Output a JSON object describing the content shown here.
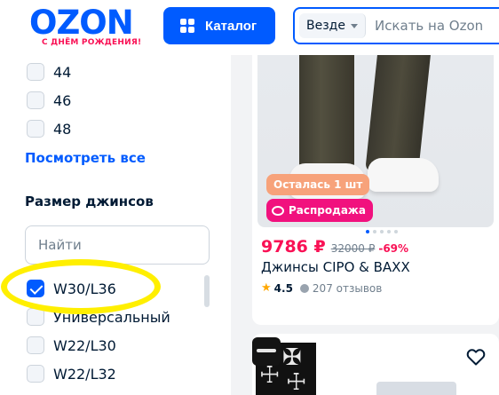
{
  "header": {
    "logo_text": "OZON",
    "logo_subtitle": "С ДНЁМ РОЖДЕНИЯ!",
    "catalog_label": "Каталог",
    "search_scope": "Везде",
    "search_placeholder": "Искать на Ozon"
  },
  "sidebar": {
    "sizes_top": [
      {
        "label": "44",
        "checked": false
      },
      {
        "label": "46",
        "checked": false
      },
      {
        "label": "48",
        "checked": false
      }
    ],
    "show_all": "Посмотреть все",
    "jeans_size_title": "Размер джинсов",
    "find_placeholder": "Найти",
    "jeans_sizes": [
      {
        "label": "W30/L36",
        "checked": true
      },
      {
        "label": "Универсальный",
        "checked": false
      },
      {
        "label": "W22/L30",
        "checked": false
      },
      {
        "label": "W22/L32",
        "checked": false
      }
    ]
  },
  "product": {
    "stock_badge": "Осталась 1 шт",
    "sale_badge": "Распродажа",
    "price": "9786 ₽",
    "old_price": "32000 ₽",
    "discount": "-69%",
    "title": "Джинсы CIPO & BAXX",
    "rating": "4.5",
    "reviews": "207 отзывов"
  },
  "colors": {
    "brand_blue": "#005bff",
    "sale_pink": "#f91155",
    "highlight_yellow": "#ffef00"
  }
}
